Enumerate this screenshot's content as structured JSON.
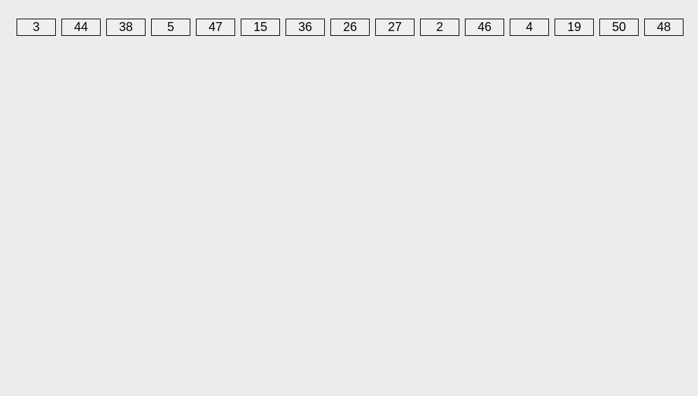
{
  "buttons": [
    {
      "label": "3"
    },
    {
      "label": "44"
    },
    {
      "label": "38"
    },
    {
      "label": "5"
    },
    {
      "label": "47"
    },
    {
      "label": "15"
    },
    {
      "label": "36"
    },
    {
      "label": "26"
    },
    {
      "label": "27"
    },
    {
      "label": "2"
    },
    {
      "label": "46"
    },
    {
      "label": "4"
    },
    {
      "label": "19"
    },
    {
      "label": "50"
    },
    {
      "label": "48"
    }
  ]
}
